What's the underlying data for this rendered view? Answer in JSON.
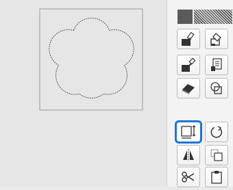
{
  "canvas": {
    "shape": "five-petal-flower",
    "outline": "dotted"
  },
  "palette": {
    "primary_color": "#5a5a5a",
    "secondary_pattern": "hatched"
  },
  "tools": [
    {
      "id": "fill-shape",
      "icon": "paint-bucket-fill-icon"
    },
    {
      "id": "fill-line",
      "icon": "paint-bucket-outline-icon"
    },
    {
      "id": "pick-shape-color",
      "icon": "eyedropper-fill-icon"
    },
    {
      "id": "pick-line-style",
      "icon": "eyedropper-line-style-icon"
    },
    {
      "id": "eraser",
      "icon": "eraser-icon"
    },
    {
      "id": "merge-shapes",
      "icon": "overlap-shapes-icon"
    },
    {
      "id": "resize",
      "icon": "resize-box-icon",
      "selected": true
    },
    {
      "id": "rotate",
      "icon": "rotate-icon"
    },
    {
      "id": "flip",
      "icon": "flip-horizontal-icon"
    },
    {
      "id": "duplicate",
      "icon": "duplicate-icon"
    },
    {
      "id": "cut",
      "icon": "scissors-icon"
    },
    {
      "id": "paste",
      "icon": "clipboard-icon"
    }
  ],
  "colors": {
    "selection": "#1e73d8",
    "icon": "#333333"
  }
}
